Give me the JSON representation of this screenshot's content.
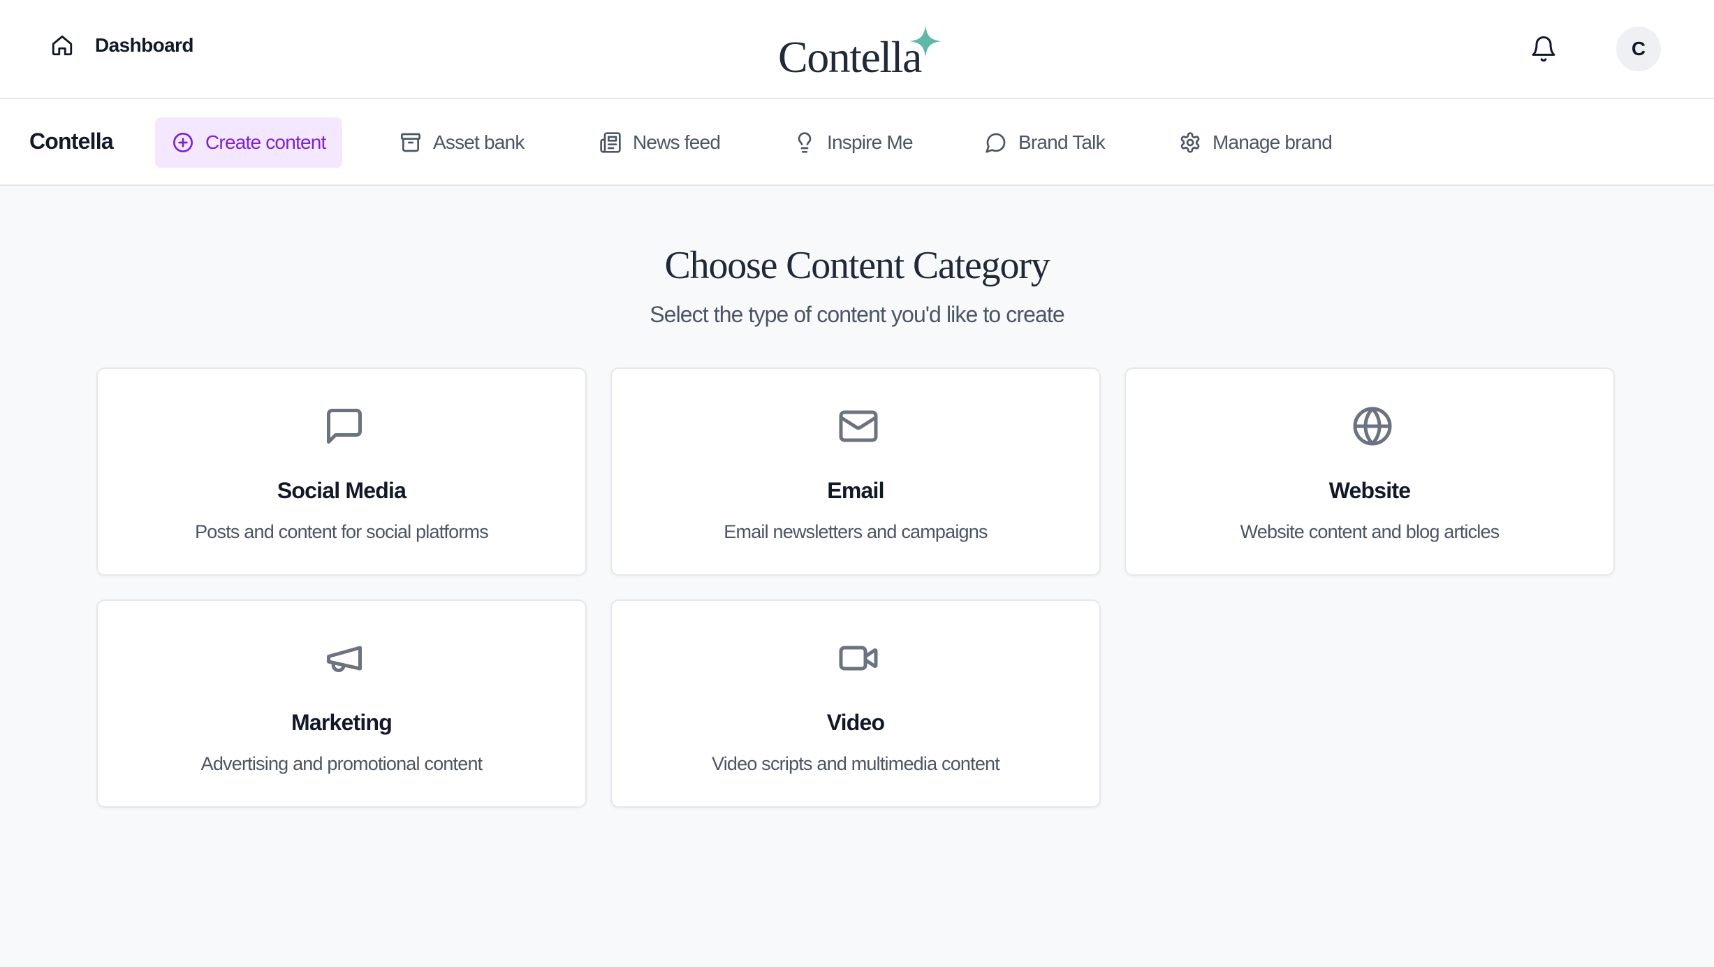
{
  "header": {
    "dashboard_label": "Dashboard",
    "logo_text": "Contella",
    "avatar_initial": "C"
  },
  "nav": {
    "brand": "Contella",
    "items": [
      {
        "label": "Create content",
        "icon": "plus-circle-icon",
        "active": true
      },
      {
        "label": "Asset bank",
        "icon": "archive-icon",
        "active": false
      },
      {
        "label": "News feed",
        "icon": "newspaper-icon",
        "active": false
      },
      {
        "label": "Inspire Me",
        "icon": "lightbulb-icon",
        "active": false
      },
      {
        "label": "Brand Talk",
        "icon": "chat-bubble-icon",
        "active": false
      },
      {
        "label": "Manage brand",
        "icon": "gear-icon",
        "active": false
      }
    ]
  },
  "main": {
    "title": "Choose Content Category",
    "subtitle": "Select the type of content you'd like to create",
    "categories": [
      {
        "title": "Social Media",
        "description": "Posts and content for social platforms",
        "icon": "message-square-icon"
      },
      {
        "title": "Email",
        "description": "Email newsletters and campaigns",
        "icon": "mail-icon"
      },
      {
        "title": "Website",
        "description": "Website content and blog articles",
        "icon": "globe-icon"
      },
      {
        "title": "Marketing",
        "description": "Advertising and promotional content",
        "icon": "megaphone-icon"
      },
      {
        "title": "Video",
        "description": "Video scripts and multimedia content",
        "icon": "video-camera-icon"
      }
    ]
  },
  "colors": {
    "accent": "#7e22ce",
    "accent_bg": "#f3e8ff",
    "logo_star": "#5eb8a6",
    "page_bg": "#f8f9fb",
    "icon_gray": "#6b7280"
  }
}
